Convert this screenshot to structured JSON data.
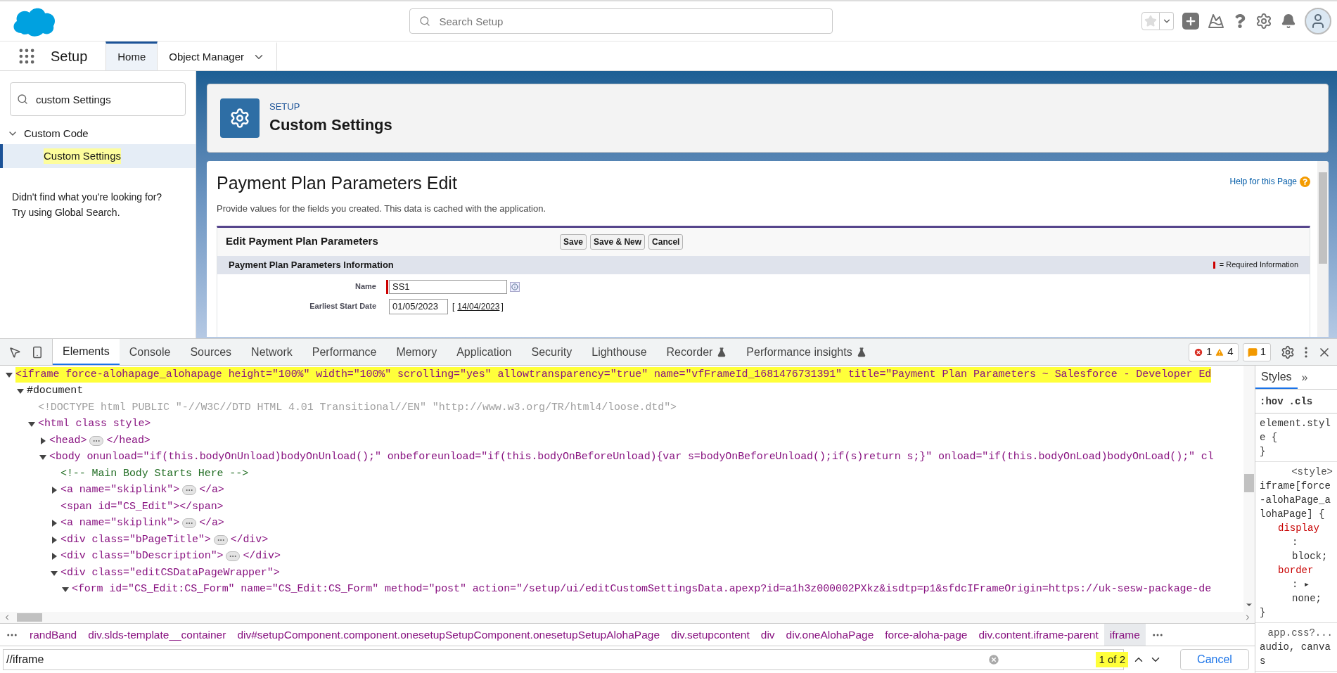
{
  "header": {
    "search": {
      "placeholder": "Search Setup"
    },
    "favorite": {
      "on": false
    }
  },
  "nav": {
    "app_name": "Setup",
    "tabs": [
      {
        "label": "Home",
        "selected": true,
        "kind": "plain"
      },
      {
        "label": "Object Manager",
        "selected": false,
        "kind": "menu"
      }
    ]
  },
  "sidebar": {
    "quick_find": {
      "value": "custom Settings"
    },
    "tree": [
      {
        "label": "Custom Code",
        "expanded": true,
        "children": [
          {
            "label": "Custom Settings",
            "selected": true,
            "highlighted": true
          }
        ]
      }
    ],
    "help": [
      "Didn't find what you're looking for?",
      "Try using Global Search."
    ]
  },
  "page_header": {
    "eyebrow": "SETUP",
    "title": "Custom Settings"
  },
  "edit_page": {
    "title": "Payment Plan Parameters Edit",
    "help_link": "Help for this Page",
    "description": "Provide values for the fields you created. This data is cached with the application.",
    "form": {
      "title": "Edit Payment Plan Parameters",
      "buttons": [
        "Save",
        "Save & New",
        "Cancel"
      ],
      "section": {
        "title": "Payment Plan Parameters Information",
        "legend": "= Required Information"
      },
      "fields": [
        {
          "label": "Name",
          "value": "SS1",
          "required": true,
          "kind": "text"
        },
        {
          "label": "Earliest Start Date",
          "value": "01/05/2023",
          "required": false,
          "kind": "date",
          "link_open": "[",
          "link": "14/04/2023",
          "link_close": "]"
        }
      ]
    }
  },
  "devtools": {
    "tabs": [
      {
        "label": "Elements",
        "selected": true,
        "experimental": false
      },
      {
        "label": "Console",
        "selected": false,
        "experimental": false
      },
      {
        "label": "Sources",
        "selected": false,
        "experimental": false
      },
      {
        "label": "Network",
        "selected": false,
        "experimental": false
      },
      {
        "label": "Performance",
        "selected": false,
        "experimental": false
      },
      {
        "label": "Memory",
        "selected": false,
        "experimental": false
      },
      {
        "label": "Application",
        "selected": false,
        "experimental": false
      },
      {
        "label": "Security",
        "selected": false,
        "experimental": false
      },
      {
        "label": "Lighthouse",
        "selected": false,
        "experimental": false
      },
      {
        "label": "Recorder",
        "selected": false,
        "experimental": true
      },
      {
        "label": "Performance insights",
        "selected": false,
        "experimental": true
      }
    ],
    "console_counts": {
      "errors": "1",
      "warnings": "4"
    },
    "issues": "1",
    "dom_tree": [
      {
        "kind": "element",
        "text": "<iframe force-alohapage_alohapage height=\"100%\" width=\"100%\" scrolling=\"yes\" allowtransparency=\"true\" name=\"vfFrameId_1681476731391\" title=\"Payment Plan Parameters ~ Salesforce - Developer Ed",
        "expanded": true,
        "highlighted": true,
        "children": [
          {
            "kind": "document",
            "text": "#document",
            "expanded": true,
            "highlighted": false,
            "children": [
              {
                "kind": "doctype",
                "text": "<!DOCTYPE html PUBLIC \"-//W3C//DTD HTML 4.01 Transitional//EN\" \"http://www.w3.org/TR/html4/loose.dtd\">",
                "highlighted": false
              },
              {
                "kind": "element",
                "text": "<html class style>",
                "expanded": true,
                "highlighted": false,
                "children": [
                  {
                    "kind": "element",
                    "text": "<head>",
                    "closing": "</head>",
                    "expanded": false,
                    "highlighted": false
                  },
                  {
                    "kind": "element",
                    "text": "<body onunload=\"if(this.bodyOnUnload)bodyOnUnload();\" onbeforeunload=\"if(this.bodyOnBeforeUnload){var s=bodyOnBeforeUnload();if(s)return s;}\" onload=\"if(this.bodyOnLoad)bodyOnLoad();\" cl",
                    "expanded": true,
                    "highlighted": false,
                    "children": [
                      {
                        "kind": "comment",
                        "text": "<!-- Main Body Starts Here -->",
                        "highlighted": false
                      },
                      {
                        "kind": "element",
                        "text": "<a name=\"skiplink\">",
                        "closing": "</a>",
                        "expanded": false,
                        "highlighted": false
                      },
                      {
                        "kind": "leaf",
                        "text": "<span id=\"CS_Edit\"></span>",
                        "highlighted": false
                      },
                      {
                        "kind": "element",
                        "text": "<a name=\"skiplink\">",
                        "closing": "</a>",
                        "expanded": false,
                        "highlighted": false
                      },
                      {
                        "kind": "element",
                        "text": "<div class=\"bPageTitle\">",
                        "closing": "</div>",
                        "expanded": false,
                        "highlighted": false
                      },
                      {
                        "kind": "element",
                        "text": "<div class=\"bDescription\">",
                        "closing": "</div>",
                        "expanded": false,
                        "highlighted": false
                      },
                      {
                        "kind": "element",
                        "text": "<div class=\"editCSDataPageWrapper\">",
                        "expanded": true,
                        "highlighted": false,
                        "children": [
                          {
                            "kind": "element",
                            "text": "<form id=\"CS_Edit:CS_Form\" name=\"CS_Edit:CS_Form\" method=\"post\" action=\"/setup/ui/editCustomSettingsData.apexp?id=a1h3z000002PXkz&isdtp=p1&sfdcIFrameOrigin=https://uk-sesw-package-de",
                            "expanded": true,
                            "highlighted": false
                          }
                        ]
                      }
                    ]
                  }
                ]
              }
            ]
          }
        ]
      }
    ],
    "breadcrumbs": [
      {
        "label": "randBand",
        "selected": false
      },
      {
        "label": "div.slds-template__container",
        "selected": false
      },
      {
        "label": "div#setupComponent.component.onesetupSetupComponent.onesetupSetupAlohaPage",
        "selected": false
      },
      {
        "label": "div.setupcontent",
        "selected": false
      },
      {
        "label": "div",
        "selected": false
      },
      {
        "label": "div.oneAlohaPage",
        "selected": false
      },
      {
        "label": "force-aloha-page",
        "selected": false
      },
      {
        "label": "div.content.iframe-parent",
        "selected": false
      },
      {
        "label": "iframe",
        "selected": true
      }
    ],
    "search": {
      "value": "//iframe",
      "matches": "1 of 2",
      "cancel": "Cancel"
    },
    "styles": {
      "tabs": [
        {
          "label": "Styles",
          "selected": true
        }
      ],
      "more": "»",
      "filters": [
        ":hov",
        ".cls"
      ],
      "rules": [
        {
          "selector": "element.style {",
          "close": "}"
        },
        {
          "selector": "iframe[force-alohaPage_alohaPage] {",
          "source": "<style>",
          "properties": [
            {
              "name": "display",
              "value": ": block;"
            },
            {
              "name": "border",
              "value": ": ▸ none;"
            }
          ],
          "close": "}"
        },
        {
          "selector": "audio, canvas",
          "source": "app.css?..."
        }
      ]
    }
  }
}
